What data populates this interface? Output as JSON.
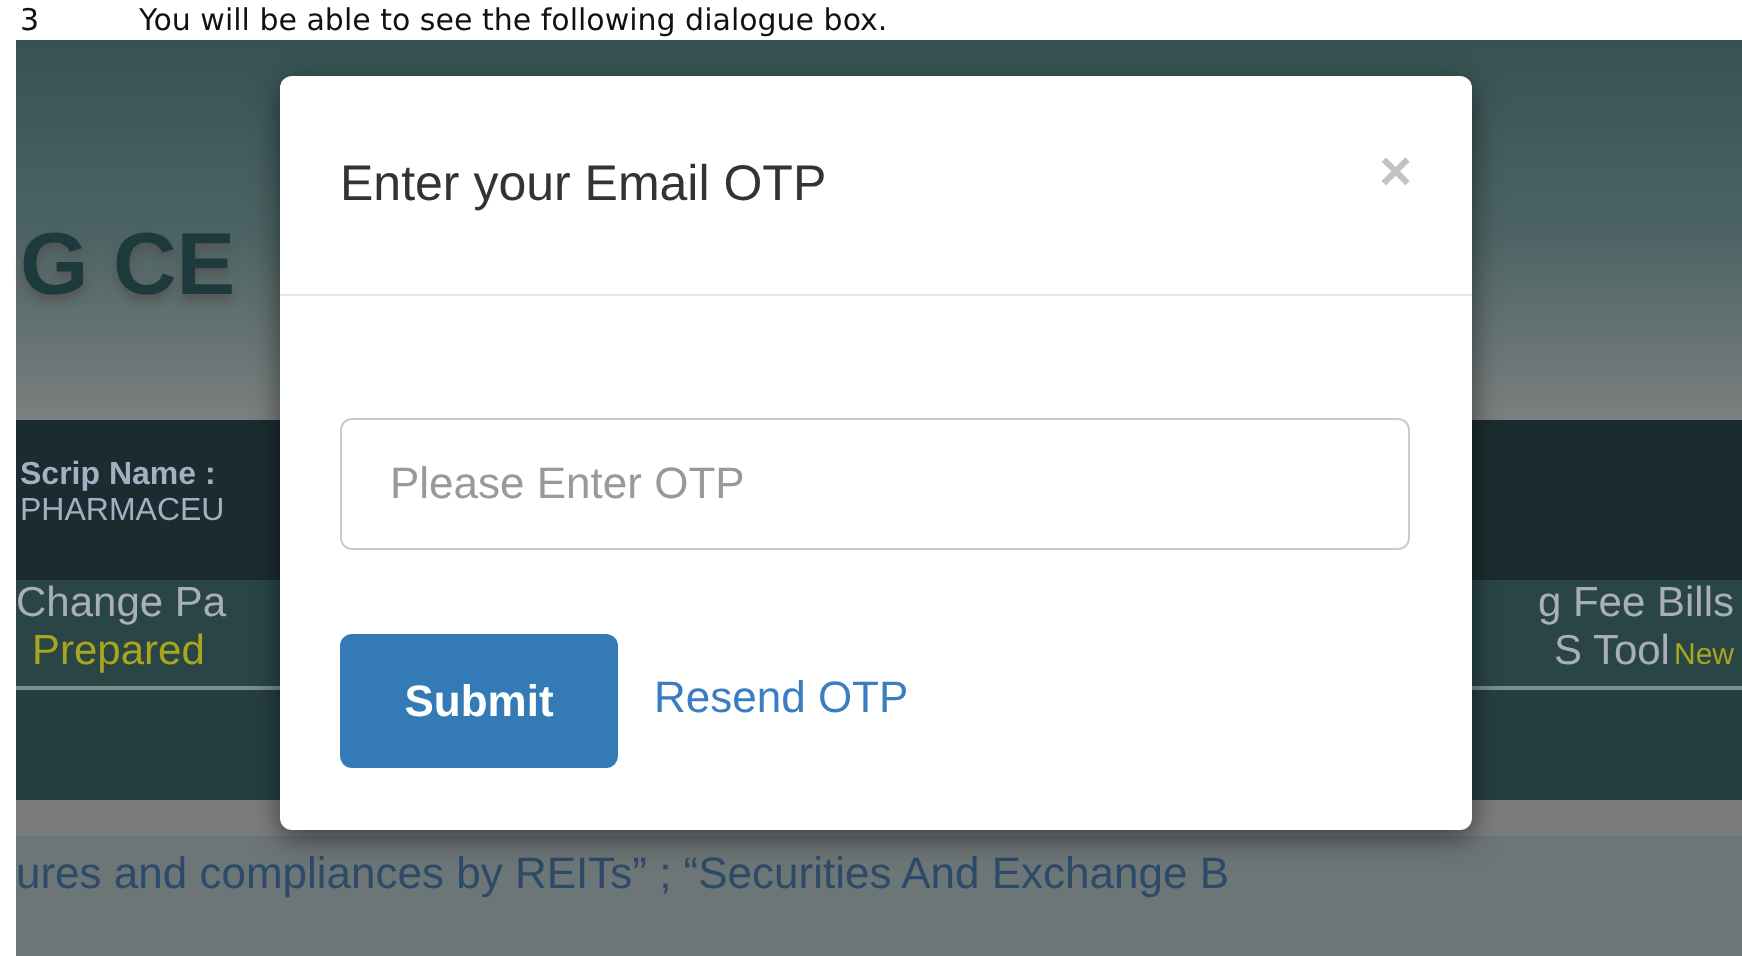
{
  "caption": {
    "number": "3",
    "text": "You will be able to see the following dialogue box."
  },
  "background_page": {
    "heading": "G CE",
    "info_bar": {
      "label": "Scrip Name :",
      "value": "PHARMACEU"
    },
    "links_left": [
      {
        "text": "Change Pa",
        "kind": "plain"
      },
      {
        "text": "Prepared",
        "kind": "highlight"
      }
    ],
    "links_right": [
      {
        "text": "g Fee Bills"
      },
      {
        "text": "S Tool",
        "badge": "New"
      }
    ],
    "notice": "ures and compliances by REITs” ; “Securities And Exchange B"
  },
  "dialog": {
    "title": "Enter your Email OTP",
    "close": "×",
    "otp_field": {
      "placeholder": "Please Enter OTP"
    },
    "submit": "Submit",
    "resend": "Resend OTP"
  }
}
